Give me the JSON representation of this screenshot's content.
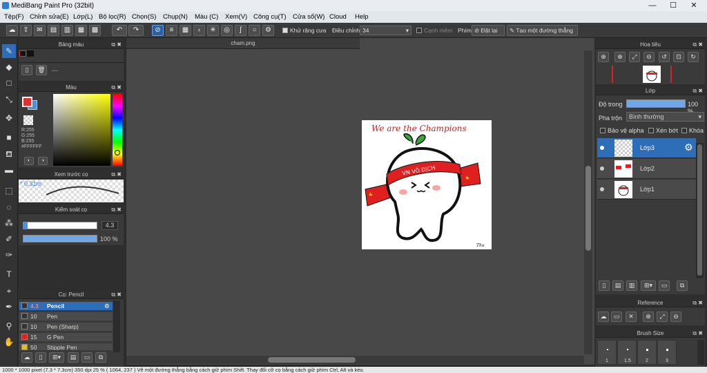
{
  "app": {
    "title": "MediBang Paint Pro (32bit)"
  },
  "menu": [
    "Tệp(F)",
    "Chỉnh sửa(E)",
    "Lớp(L)",
    "Bộ lọc(R)",
    "Chọn(S)",
    "Chụp(N)",
    "Màu (C)",
    "Xem(V)",
    "Công cụ(T)",
    "Cửa sổ(W)",
    "Cloud",
    "Help"
  ],
  "toolbar": {
    "antialias_label": "Khử răng cưa",
    "adjust_label": "Điều chỉnh",
    "adjust_value": "34",
    "edge_label": "Cạnh mềm",
    "key_label": "Phím",
    "reset_label": "Đặt lại",
    "straight_line_label": "Tạo một đường thẳng"
  },
  "panels": {
    "palette": {
      "title": "Bảng màu",
      "value": "---"
    },
    "color": {
      "title": "Màu",
      "r": "R:255",
      "g": "G:255",
      "b": "B:255",
      "hex": "#FFFFFF"
    },
    "preview": {
      "title": "Xem trước cọ",
      "size": "0.31m"
    },
    "brush_control": {
      "title": "Kiểm soát cọ",
      "size_value": "4.3",
      "opacity_value": "100 %"
    },
    "brush_list": {
      "title": "Cọ: Pencil",
      "items": [
        {
          "size": "4.3",
          "name": "Pencil",
          "color": "#333333"
        },
        {
          "size": "10",
          "name": "Pen",
          "color": "#333333"
        },
        {
          "size": "10",
          "name": "Pen (Sharp)",
          "color": "#333333"
        },
        {
          "size": "15",
          "name": "G Pen",
          "color": "#e02020"
        },
        {
          "size": "50",
          "name": "Stipple Pen",
          "color": "#e0c020"
        }
      ]
    },
    "navigator": {
      "title": "Hoa tiêu"
    },
    "layers": {
      "title": "Lớp",
      "opacity_label": "Độ trong",
      "opacity_value": "100 %",
      "blend_label": "Pha trộn",
      "blend_value": "Bình thường",
      "protect_alpha": "Bảo vệ alpha",
      "clip": "Xén bớt",
      "lock": "Khóa",
      "items": [
        {
          "name": "Lớp3"
        },
        {
          "name": "Lớp2"
        },
        {
          "name": "Lớp1"
        }
      ]
    },
    "reference": {
      "title": "Reference"
    },
    "brush_size": {
      "title": "Brush Size",
      "sizes": [
        "1",
        "1.5",
        "2",
        "3"
      ]
    }
  },
  "document": {
    "tab": "cham.png",
    "art": {
      "header_text": "We are the Champions",
      "band_text": "VN VÔ ĐỊCH",
      "signature": "Thu"
    }
  },
  "status": {
    "text": "1000 * 1000 pixel   (7.3 * 7.3cm)   350 dpi   25 %   ( 1064, 237 )   Vẽ một đường thẳng bằng cách giữ phím Shift. Thay đổi cỡ cọ bằng cách giữ phím Ctrl, Alt và kéo."
  },
  "colors": {
    "accent": "#2e6db8",
    "primary_color": "#e03030",
    "secondary_color": "#4a90e2"
  }
}
